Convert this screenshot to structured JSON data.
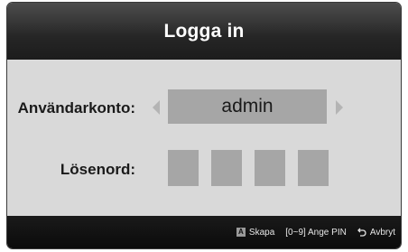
{
  "dialog": {
    "title": "Logga in",
    "account_label": "Användarkonto:",
    "account_value": "admin",
    "password_label": "Lösenord:",
    "pin_box_count": 4
  },
  "footer": {
    "key_a_glyph": "A",
    "create_label": "Skapa",
    "pin_hint": "[0~9] Ange PIN",
    "cancel_label": "Avbryt"
  },
  "colors": {
    "title_bar": "#262626",
    "body_background": "#d9d9d9",
    "field_fill": "#a6a6a6",
    "footer_background": "#111111",
    "arrow": "#b4b4b4"
  },
  "icons": [
    "arrow-left-icon",
    "arrow-right-icon",
    "a-key-icon",
    "return-icon"
  ]
}
